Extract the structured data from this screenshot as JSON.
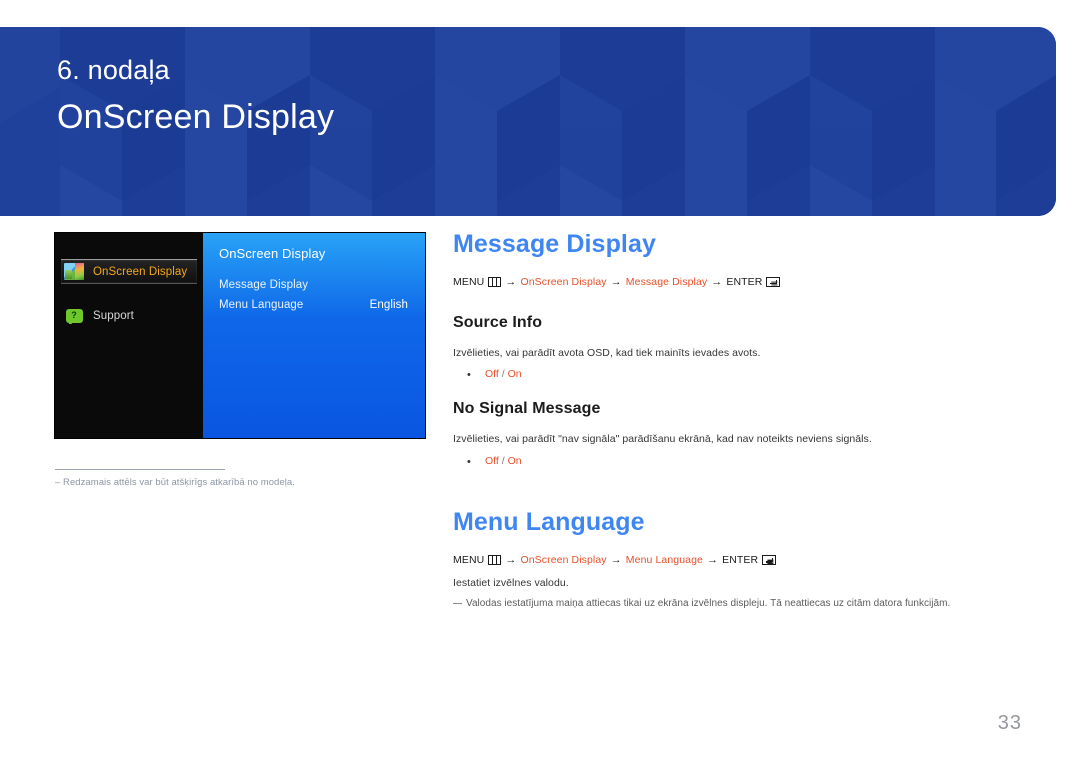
{
  "header": {
    "chapter_label": "6. nodaļa",
    "chapter_title": "OnScreen Display",
    "background_color": "#1f409b"
  },
  "osd_mockup": {
    "sidebar_items": [
      {
        "label": "OnScreen Display",
        "icon": "picture-icon",
        "selected": true
      },
      {
        "label": "Support",
        "icon": "support-bubble-icon",
        "selected": false
      }
    ],
    "panel_title": "OnScreen Display",
    "rows": [
      {
        "label": "Message Display",
        "value": ""
      },
      {
        "label": "Menu Language",
        "value": "English"
      }
    ],
    "footnote": "Redzamais attēls var būt atšķirīgs atkarībā no modeļa."
  },
  "content": {
    "sections": [
      {
        "title": "Message Display",
        "breadcrumb": {
          "menu_label": "MENU",
          "menu_icon": "menu-icon",
          "steps": [
            "OnScreen Display",
            "Message Display"
          ],
          "enter_label": "ENTER",
          "enter_icon": "enter-icon",
          "arrow": "→"
        },
        "subsections": [
          {
            "title": "Source Info",
            "description": "Izvēlieties, vai parādīt avota OSD, kad tiek mainīts ievades avots.",
            "options": [
              "Off",
              "On"
            ],
            "separator": "/"
          },
          {
            "title": "No Signal Message",
            "description": "Izvēlieties, vai parādīt \"nav signāla\" parādīšanu ekrānā, kad nav noteikts neviens signāls.",
            "options": [
              "Off",
              "On"
            ],
            "separator": "/"
          }
        ]
      },
      {
        "title": "Menu Language",
        "breadcrumb": {
          "menu_label": "MENU",
          "menu_icon": "menu-icon",
          "steps": [
            "OnScreen Display",
            "Menu Language"
          ],
          "enter_label": "ENTER",
          "enter_icon": "enter-icon",
          "arrow": "→"
        },
        "description": "Iestatiet izvēlnes valodu.",
        "note": "Valodas iestatījuma maiņa attiecas tikai uz ekrāna izvēlnes displeju. Tā neattiecas uz citām datora funkcijām."
      }
    ]
  },
  "footer": {
    "page_number": "33"
  },
  "colors": {
    "accent_blue": "#3f86f2",
    "accent_orange": "#e8502a",
    "banner_blue": "#1f409b",
    "osd_highlight": "#f4a61c"
  }
}
